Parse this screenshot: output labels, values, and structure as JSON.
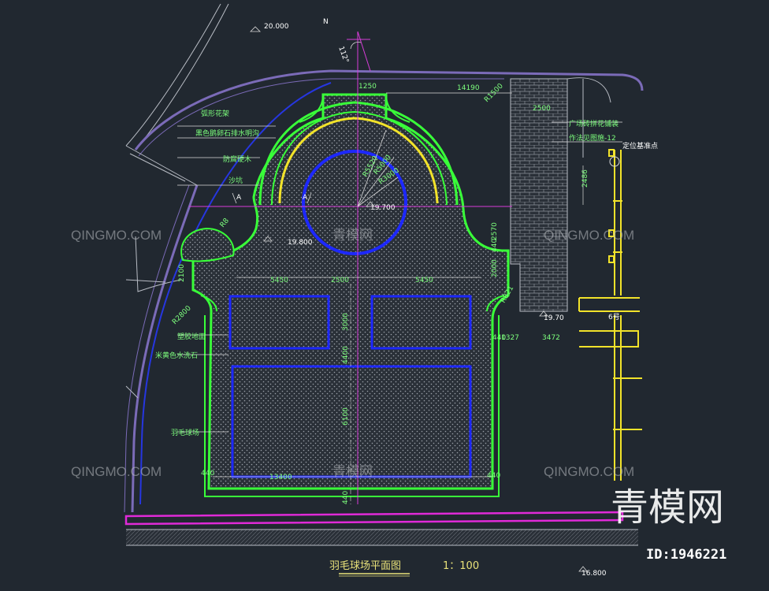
{
  "drawing": {
    "title": "羽毛球场平面图",
    "scale": "1：100",
    "north": "N",
    "angle": "112°"
  },
  "labels": {
    "arc_trellis": "弧形花架",
    "black_pebble_drain": "黑色鹅卵石排水明沟",
    "wood_edge": "防腐硬木",
    "sandpit": "沙坑",
    "rubber_floor": "塑胶地面",
    "rice_wash_stone": "米黄色水洗石",
    "badminton_court": "羽毛球场",
    "paving_note_1": "广场砖拼花铺装",
    "paving_note_2": "作法见图施-12",
    "datum_point": "定位基准点",
    "building_no": "6号",
    "section_a1": "A",
    "section_a2": "A"
  },
  "elevations": {
    "e1": "20.000",
    "e2": "19.700",
    "e3": "19.800",
    "e4": "19.70",
    "e5": "16.800"
  },
  "dimensions": {
    "d1250": "1250",
    "d14190": "14190",
    "r1500": "R1500",
    "d2500a": "2500",
    "d2486": "2486",
    "r5520": "R5520",
    "r5000": "R5000",
    "r3000": "R3000",
    "d2570": "2570",
    "d2000": "2000",
    "d440a": "440",
    "r821": "R821",
    "d5450a": "5450",
    "d2500b": "2500",
    "d5450b": "5450",
    "d2100": "2100",
    "r2800": "R2800",
    "d3000": "3000",
    "d1327": "1327",
    "d3472": "3472",
    "d4400": "4400",
    "d6100": "6100",
    "d440b": "440",
    "d13400": "13400",
    "d440c": "440",
    "d440d": "440",
    "d440e": "440",
    "r8": "R8"
  },
  "watermarks": {
    "site": "QINGMO.COM",
    "cn": "青模网",
    "brand": "青模网",
    "id": "ID:1946221"
  }
}
